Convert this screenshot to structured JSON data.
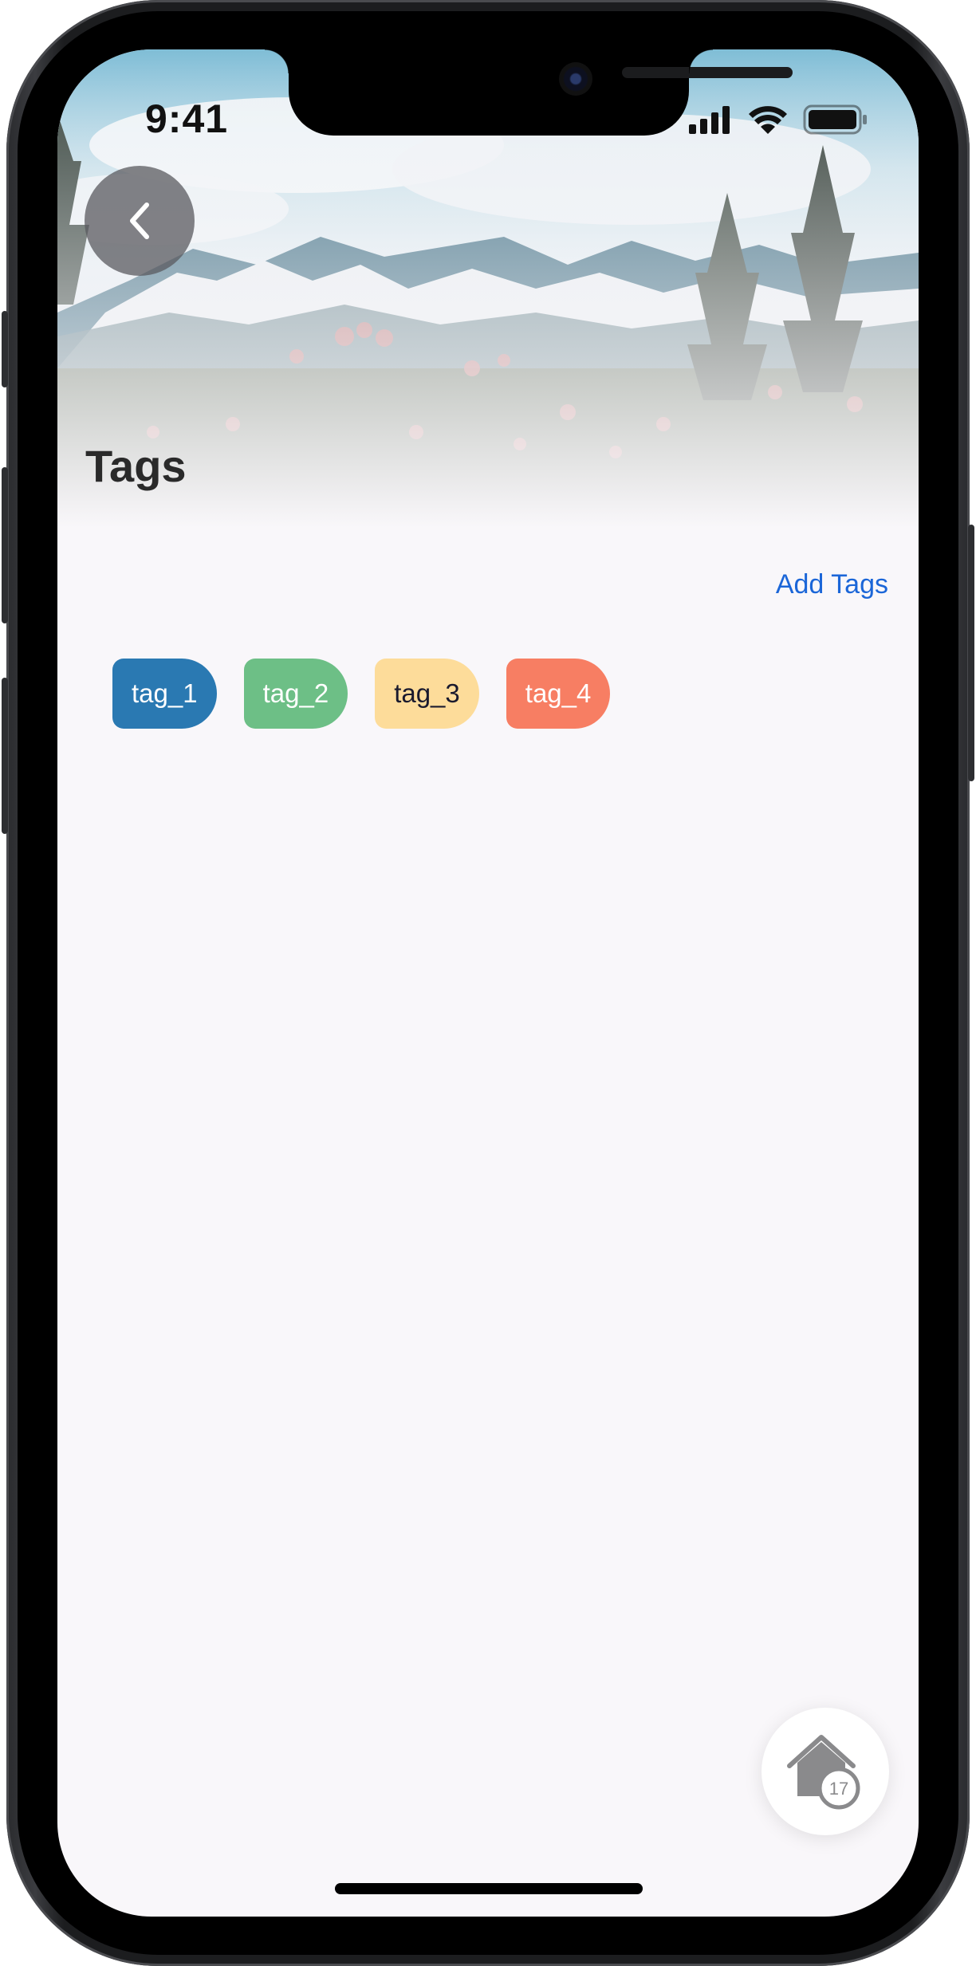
{
  "status_bar": {
    "time": "9:41"
  },
  "header": {
    "title": "Tags"
  },
  "actions": {
    "add_tags_label": "Add Tags"
  },
  "tags": [
    {
      "label": "tag_1",
      "color": "#2a79b2",
      "text_color": "#ffffff"
    },
    {
      "label": "tag_2",
      "color": "#6dbf86",
      "text_color": "#ffffff"
    },
    {
      "label": "tag_3",
      "color": "#fddc9a",
      "text_color": "#1a1a2e"
    },
    {
      "label": "tag_4",
      "color": "#f77e63",
      "text_color": "#ffffff"
    }
  ],
  "fab": {
    "icon": "home-icon",
    "badge_count": "17"
  },
  "colors": {
    "accent": "#1b66d8",
    "background": "#f9f7fa"
  }
}
